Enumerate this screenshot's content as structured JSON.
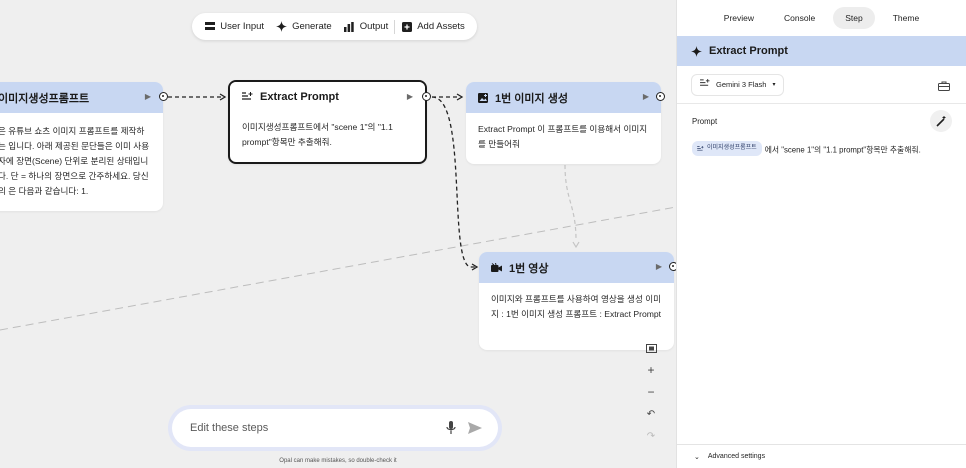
{
  "toolbar": {
    "user_input": "User Input",
    "generate": "Generate",
    "output": "Output",
    "add_assets": "Add Assets"
  },
  "nodes": {
    "prompt_source": {
      "title": "이미지생성프롬프트",
      "body": "은 유튜브 쇼츠 이미지 프롬프트를 제작하는 입니다. 아래 제공된 문단들은 이미 사용자에 장면(Scene) 단위로 분리된 상태입니다. 단 = 하나의 장면으로 간주하세요. 당신의 은 다음과 같습니다: 1."
    },
    "extract_prompt": {
      "title": "Extract Prompt",
      "body": "이미지생성프롬프트에서 \"scene 1\"의 \"1.1 prompt\"항목만 추출해줘."
    },
    "image_gen": {
      "title": "1번 이미지 생성",
      "body": "Extract Prompt 이 프롬프트를 이용해서 이미지를 만들어줘"
    },
    "video": {
      "title": "1번 영상",
      "body": "이미지와 프롬프트를 사용하여 영상을 생성 이미지 : 1번 이미지 생성 프롬프트 : Extract Prompt"
    }
  },
  "chat": {
    "placeholder": "Edit these steps",
    "disclaimer": "Opal can make mistakes, so double-check it"
  },
  "panel": {
    "tabs": [
      "Preview",
      "Console",
      "Step",
      "Theme"
    ],
    "active_tab": "Step",
    "title": "Extract Prompt",
    "model": "Gemini 3 Flash",
    "prompt_label": "Prompt",
    "prompt_chip": "이미지생성프롬프트",
    "prompt_text": "에서 \"scene 1\"의 \"1.1 prompt\"항목만 추출해줘.",
    "advanced": "Advanced settings"
  },
  "colors": {
    "node_header": "#c8d7f2",
    "canvas": "#efefef",
    "chat_ring": "#e2e6f7"
  }
}
